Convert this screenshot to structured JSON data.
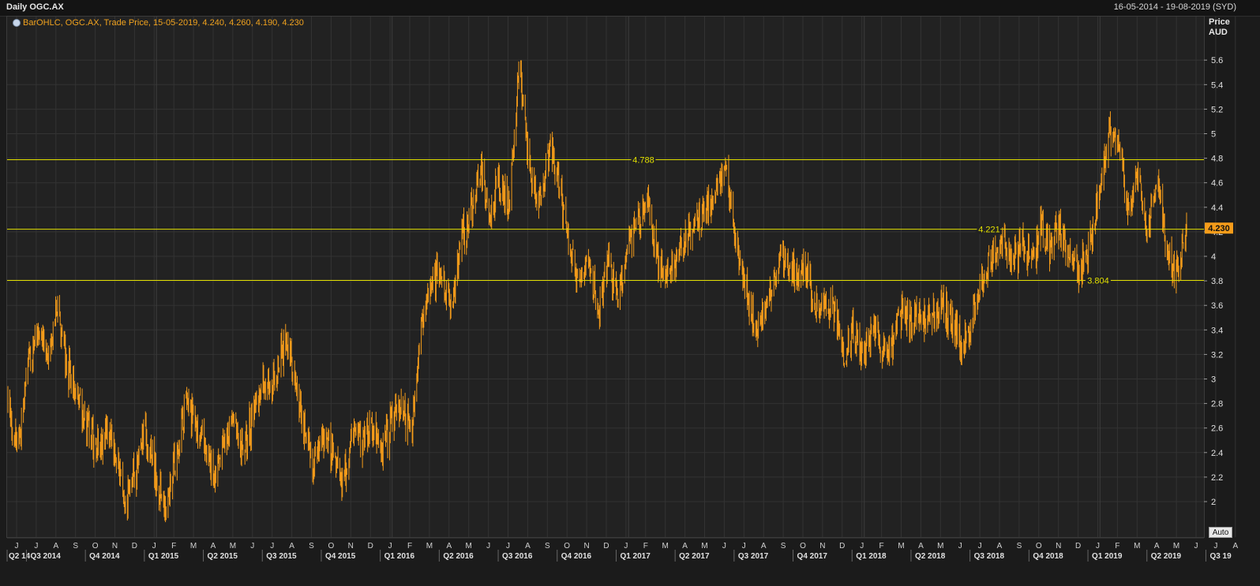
{
  "window": {
    "title": "Daily OGC.AX",
    "date_range": "16-05-2014 - 19-08-2019 (SYD)"
  },
  "legend": {
    "text": "BarOHLC, OGC.AX, Trade Price, 15-05-2019, 4.240, 4.260, 4.190, 4.230"
  },
  "axis": {
    "y_title": "Price",
    "y_unit": "AUD",
    "auto_label": "Auto"
  },
  "colors": {
    "bars": "#f59c1a",
    "levels": "#e2e000",
    "last_price_tag": "#f59c1a",
    "background": "#222222",
    "grid": "#333333"
  },
  "chart_data": {
    "type": "ohlc-bar",
    "series_name": "OGC.AX",
    "ylim": [
      1.8,
      5.8
    ],
    "grid": true,
    "y_ticks": [
      "2",
      "2.2",
      "2.4",
      "2.6",
      "2.8",
      "3",
      "3.2",
      "3.4",
      "3.6",
      "3.8",
      "4",
      "4.2",
      "4.4",
      "4.6",
      "4.8",
      "5",
      "5.2",
      "5.4",
      "5.6"
    ],
    "x_month_labels": [
      "J",
      "J",
      "A",
      "S",
      "O",
      "N",
      "D",
      "J",
      "F",
      "M",
      "A",
      "M",
      "J",
      "J",
      "A",
      "S",
      "O",
      "N",
      "D",
      "J",
      "F",
      "M",
      "A",
      "M",
      "J",
      "J",
      "A",
      "S",
      "O",
      "N",
      "D",
      "J",
      "F",
      "M",
      "A",
      "M",
      "J",
      "J",
      "A",
      "S",
      "O",
      "N",
      "D",
      "J",
      "F",
      "M",
      "A",
      "M",
      "J",
      "J",
      "A",
      "S",
      "O",
      "N",
      "D",
      "J",
      "F",
      "M",
      "A",
      "M",
      "J",
      "J",
      "A"
    ],
    "x_quarter_labels": [
      "Q2 14",
      "Q3 2014",
      "Q4 2014",
      "Q1 2015",
      "Q2 2015",
      "Q3 2015",
      "Q4 2015",
      "Q1 2016",
      "Q2 2016",
      "Q3 2016",
      "Q4 2016",
      "Q1 2017",
      "Q2 2017",
      "Q3 2017",
      "Q4 2017",
      "Q1 2018",
      "Q2 2018",
      "Q3 2018",
      "Q4 2018",
      "Q1 2019",
      "Q2 2019",
      "Q3 19"
    ],
    "horizontal_levels": [
      {
        "value": 4.788,
        "label": "4.788"
      },
      {
        "value": 4.221,
        "label": "4.221"
      },
      {
        "value": 3.804,
        "label": "3.804"
      }
    ],
    "last_price": {
      "value": 4.23,
      "label": "4.230"
    },
    "last_bar": {
      "date": "15-05-2019",
      "open": 4.24,
      "high": 4.26,
      "low": 4.19,
      "close": 4.23
    },
    "price_path": [
      [
        "2014-05-16",
        2.75
      ],
      [
        "2014-06-01",
        2.45
      ],
      [
        "2014-06-15",
        3.1
      ],
      [
        "2014-07-01",
        3.4
      ],
      [
        "2014-07-15",
        3.2
      ],
      [
        "2014-08-01",
        3.55
      ],
      [
        "2014-08-15",
        3.1
      ],
      [
        "2014-09-01",
        2.85
      ],
      [
        "2014-09-15",
        2.65
      ],
      [
        "2014-10-01",
        2.4
      ],
      [
        "2014-10-15",
        2.6
      ],
      [
        "2014-11-01",
        2.35
      ],
      [
        "2014-11-15",
        1.95
      ],
      [
        "2014-12-01",
        2.3
      ],
      [
        "2014-12-15",
        2.55
      ],
      [
        "2015-01-01",
        2.15
      ],
      [
        "2015-01-15",
        1.95
      ],
      [
        "2015-02-01",
        2.35
      ],
      [
        "2015-02-15",
        2.8
      ],
      [
        "2015-03-01",
        2.65
      ],
      [
        "2015-03-15",
        2.45
      ],
      [
        "2015-04-01",
        2.15
      ],
      [
        "2015-04-15",
        2.5
      ],
      [
        "2015-05-01",
        2.65
      ],
      [
        "2015-05-15",
        2.4
      ],
      [
        "2015-06-01",
        2.75
      ],
      [
        "2015-06-15",
        3.0
      ],
      [
        "2015-07-01",
        2.95
      ],
      [
        "2015-07-15",
        3.25
      ],
      [
        "2015-08-01",
        3.1
      ],
      [
        "2015-08-15",
        2.65
      ],
      [
        "2015-09-01",
        2.3
      ],
      [
        "2015-09-15",
        2.55
      ],
      [
        "2015-10-01",
        2.4
      ],
      [
        "2015-10-15",
        2.15
      ],
      [
        "2015-11-01",
        2.55
      ],
      [
        "2015-11-15",
        2.5
      ],
      [
        "2015-12-01",
        2.6
      ],
      [
        "2015-12-15",
        2.45
      ],
      [
        "2016-01-01",
        2.65
      ],
      [
        "2016-01-15",
        2.75
      ],
      [
        "2016-02-01",
        2.6
      ],
      [
        "2016-02-15",
        3.5
      ],
      [
        "2016-03-01",
        3.75
      ],
      [
        "2016-03-15",
        3.9
      ],
      [
        "2016-04-01",
        3.6
      ],
      [
        "2016-04-15",
        4.1
      ],
      [
        "2016-05-01",
        4.3
      ],
      [
        "2016-05-15",
        4.75
      ],
      [
        "2016-06-01",
        4.3
      ],
      [
        "2016-06-15",
        4.6
      ],
      [
        "2016-07-01",
        4.45
      ],
      [
        "2016-07-15",
        5.55
      ],
      [
        "2016-08-01",
        4.7
      ],
      [
        "2016-08-15",
        4.45
      ],
      [
        "2016-09-01",
        4.9
      ],
      [
        "2016-09-15",
        4.6
      ],
      [
        "2016-10-01",
        4.1
      ],
      [
        "2016-10-15",
        3.75
      ],
      [
        "2016-11-01",
        4.0
      ],
      [
        "2016-11-15",
        3.55
      ],
      [
        "2016-12-01",
        4.0
      ],
      [
        "2016-12-15",
        3.6
      ],
      [
        "2017-01-01",
        4.1
      ],
      [
        "2017-01-15",
        4.3
      ],
      [
        "2017-02-01",
        4.4
      ],
      [
        "2017-02-15",
        4.0
      ],
      [
        "2017-03-01",
        3.85
      ],
      [
        "2017-03-15",
        4.0
      ],
      [
        "2017-04-01",
        4.2
      ],
      [
        "2017-04-15",
        4.25
      ],
      [
        "2017-05-01",
        4.35
      ],
      [
        "2017-05-15",
        4.5
      ],
      [
        "2017-06-01",
        4.75
      ],
      [
        "2017-06-15",
        4.1
      ],
      [
        "2017-07-01",
        3.75
      ],
      [
        "2017-07-15",
        3.45
      ],
      [
        "2017-08-01",
        3.55
      ],
      [
        "2017-08-15",
        3.85
      ],
      [
        "2017-09-01",
        4.05
      ],
      [
        "2017-09-15",
        3.85
      ],
      [
        "2017-10-01",
        3.9
      ],
      [
        "2017-10-15",
        3.65
      ],
      [
        "2017-11-01",
        3.6
      ],
      [
        "2017-11-15",
        3.55
      ],
      [
        "2017-12-01",
        3.2
      ],
      [
        "2017-12-15",
        3.4
      ],
      [
        "2018-01-01",
        3.2
      ],
      [
        "2018-01-15",
        3.45
      ],
      [
        "2018-02-01",
        3.2
      ],
      [
        "2018-02-15",
        3.35
      ],
      [
        "2018-03-01",
        3.5
      ],
      [
        "2018-03-15",
        3.45
      ],
      [
        "2018-04-01",
        3.55
      ],
      [
        "2018-04-15",
        3.5
      ],
      [
        "2018-05-01",
        3.6
      ],
      [
        "2018-05-15",
        3.5
      ],
      [
        "2018-06-01",
        3.25
      ],
      [
        "2018-06-15",
        3.45
      ],
      [
        "2018-07-01",
        3.85
      ],
      [
        "2018-07-15",
        3.95
      ],
      [
        "2018-08-01",
        4.15
      ],
      [
        "2018-08-15",
        3.95
      ],
      [
        "2018-09-01",
        4.1
      ],
      [
        "2018-09-15",
        3.95
      ],
      [
        "2018-10-01",
        4.2
      ],
      [
        "2018-10-15",
        4.1
      ],
      [
        "2018-11-01",
        4.25
      ],
      [
        "2018-11-15",
        4.0
      ],
      [
        "2018-12-01",
        3.9
      ],
      [
        "2018-12-15",
        4.05
      ],
      [
        "2019-01-01",
        4.5
      ],
      [
        "2019-01-15",
        5.05
      ],
      [
        "2019-02-01",
        4.85
      ],
      [
        "2019-02-15",
        4.35
      ],
      [
        "2019-03-01",
        4.7
      ],
      [
        "2019-03-15",
        4.2
      ],
      [
        "2019-04-01",
        4.6
      ],
      [
        "2019-04-15",
        4.05
      ],
      [
        "2019-05-01",
        3.85
      ],
      [
        "2019-05-15",
        4.23
      ]
    ]
  }
}
